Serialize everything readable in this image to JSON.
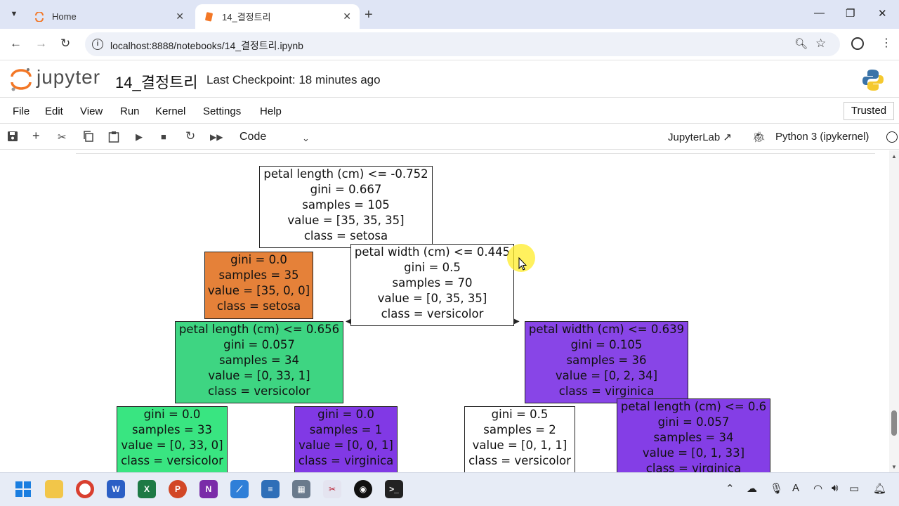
{
  "browser": {
    "tabs": [
      {
        "title": "Home",
        "active": false
      },
      {
        "title": "14_결정트리",
        "active": true
      }
    ],
    "url": "localhost:8888/notebooks/14_결정트리.ipynb"
  },
  "jupyter": {
    "logo_text": "jupyter",
    "notebook_name": "14_결정트리",
    "checkpoint": "Last Checkpoint: 18 minutes ago",
    "menu": [
      "File",
      "Edit",
      "View",
      "Run",
      "Kernel",
      "Settings",
      "Help"
    ],
    "trusted_label": "Trusted",
    "cell_type": "Code",
    "jupyterlab_label": "JupyterLab",
    "kernel_name": "Python 3 (ipykernel)"
  },
  "tree": {
    "root": {
      "lines": [
        "petal length (cm) <= -0.752",
        "gini = 0.667",
        "samples = 105",
        "value = [35, 35, 35]",
        "class = setosa"
      ],
      "color": "#ffffff"
    },
    "left1": {
      "lines": [
        "gini = 0.0",
        "samples = 35",
        "value = [35, 0, 0]",
        "class = setosa"
      ],
      "color": "#e58139"
    },
    "right1": {
      "lines": [
        "petal width (cm) <= 0.445",
        "gini = 0.5",
        "samples = 70",
        "value = [0, 35, 35]",
        "class = versicolor"
      ],
      "color": "#ffffff"
    },
    "ll2": {
      "lines": [
        "petal length (cm) <= 0.656",
        "gini = 0.057",
        "samples = 34",
        "value = [0, 33, 1]",
        "class = versicolor"
      ],
      "color": "#3ed582"
    },
    "rr2": {
      "lines": [
        "petal width (cm) <= 0.639",
        "gini = 0.105",
        "samples = 36",
        "value = [0, 2, 34]",
        "class = virginica"
      ],
      "color": "#8845e7"
    },
    "l3a": {
      "lines": [
        "gini = 0.0",
        "samples = 33",
        "value = [0, 33, 0]",
        "class = versicolor"
      ],
      "color": "#39e581"
    },
    "l3b": {
      "lines": [
        "gini = 0.0",
        "samples = 1",
        "value = [0, 0, 1]",
        "class = virginica"
      ],
      "color": "#8139e5"
    },
    "r3a": {
      "lines": [
        "gini = 0.5",
        "samples = 2",
        "value = [0, 1, 1]",
        "class = versicolor"
      ],
      "color": "#ffffff"
    },
    "r3b": {
      "lines": [
        "petal length (cm) <= 0.6",
        "gini = 0.057",
        "samples = 34",
        "value = [0, 1, 33]",
        "class = virginica"
      ],
      "color": "#843ee6"
    }
  },
  "colors": {
    "setosa": "#e58139",
    "versicolor": "#39e581",
    "virginica": "#8139e5",
    "jupyter_orange": "#f37726"
  }
}
